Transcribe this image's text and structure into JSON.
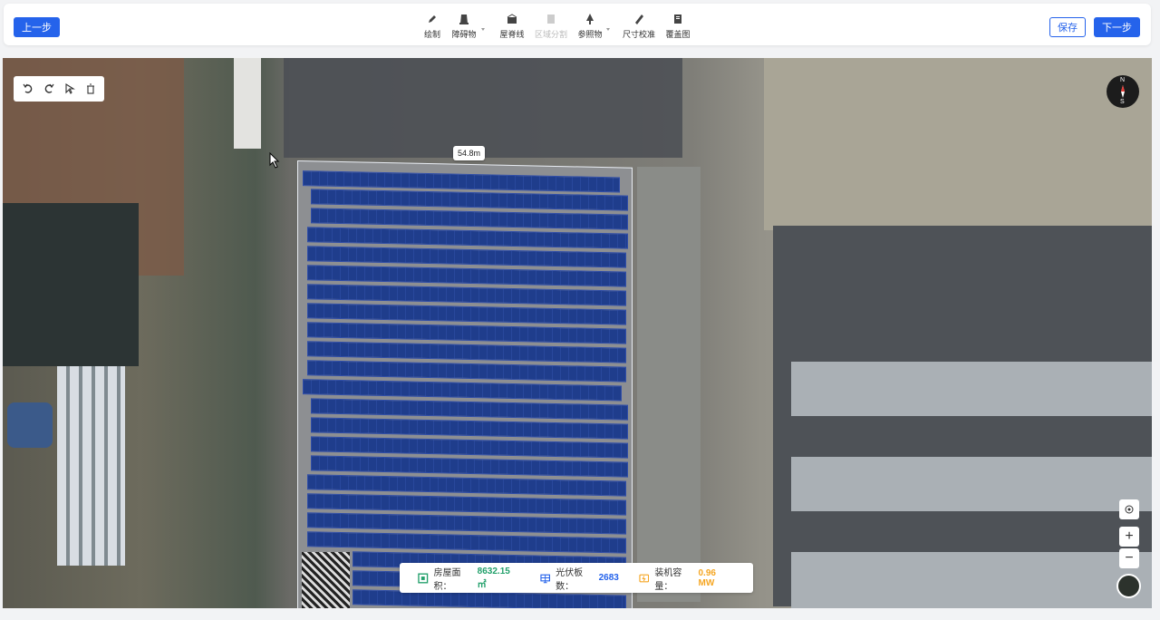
{
  "toolbar": {
    "prev_label": "上一步",
    "save_label": "保存",
    "next_label": "下一步",
    "tools": [
      {
        "label": "绘制",
        "icon": "pen-icon"
      },
      {
        "label": "障碍物",
        "icon": "obstacle-icon"
      },
      {
        "label": "屋脊线",
        "icon": "ridge-line-icon"
      },
      {
        "label": "区域分割",
        "icon": "split-icon"
      },
      {
        "label": "参照物",
        "icon": "tree-icon"
      },
      {
        "label": "尺寸校准",
        "icon": "ruler-icon"
      },
      {
        "label": "覆盖图",
        "icon": "overlay-icon"
      }
    ]
  },
  "map": {
    "dimension_label": "54.8m",
    "compass_n": "N",
    "compass_s": "S",
    "zoom_in": "+",
    "zoom_out": "−"
  },
  "stats": {
    "roof_area_label": "房屋面积：",
    "roof_area_value": "8632.15 ㎡",
    "panel_count_label": "光伏板数：",
    "panel_count_value": "2683",
    "capacity_label": "装机容量：",
    "capacity_value": "0.96 MW"
  },
  "colors": {
    "primary": "#2563eb",
    "panel": "#1f3d8c",
    "area_value": "#22a06b",
    "panel_value": "#2563eb",
    "capacity_value": "#f5a623"
  }
}
